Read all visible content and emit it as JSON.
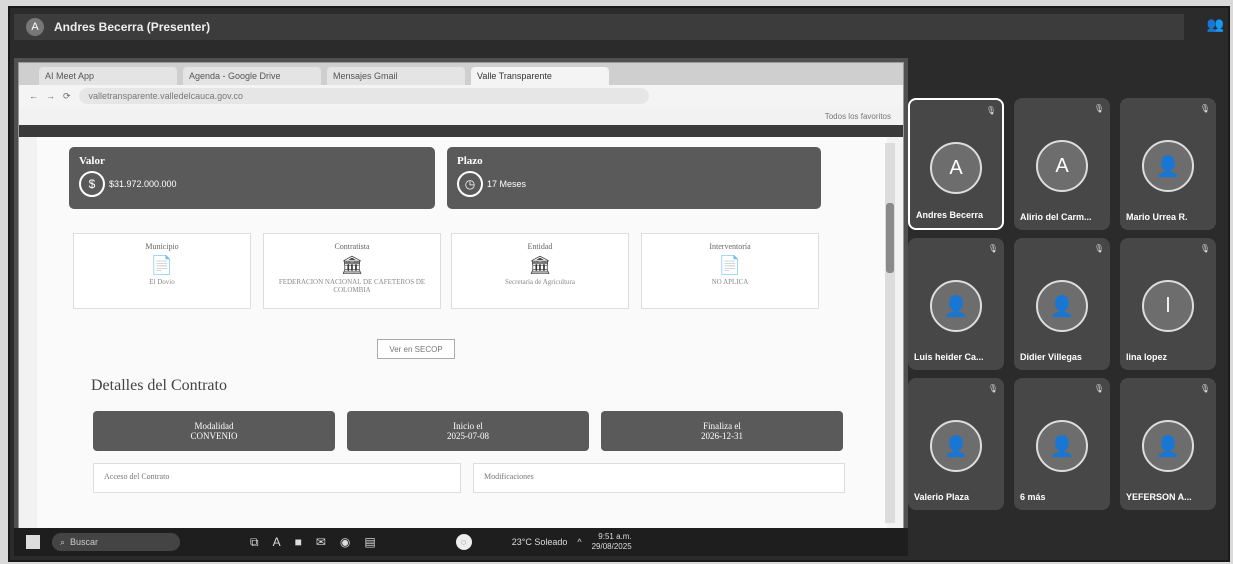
{
  "meeting": {
    "presenter_initial": "A",
    "presenter_label": "Andres Becerra (Presenter)"
  },
  "browser": {
    "tabs": [
      "AI Meet App",
      "Agenda - Google Drive",
      "Mensajes Gmail",
      "Valle Transparente"
    ],
    "url": "valletransparente.valledelcauca.gov.co",
    "bookmarks_label": "Todos los favoritos"
  },
  "page": {
    "value_card": {
      "label": "Valor",
      "amount": "$31.972.000.000"
    },
    "term_card": {
      "label": "Plazo",
      "value": "17 Meses"
    },
    "info_cards": [
      {
        "title": "Municipio",
        "icon": "📄",
        "value": "El Dovio"
      },
      {
        "title": "Contratista",
        "icon": "🏛",
        "value": "FEDERACION NACIONAL DE CAFETEROS DE COLOMBIA"
      },
      {
        "title": "Entidad",
        "icon": "🏛",
        "value": "Secretaría de Agricultura"
      },
      {
        "title": "Interventoría",
        "icon": "📄",
        "value": "NO APLICA"
      }
    ],
    "more_button": "Ver en SECOP",
    "section_title": "Detalles del Contrato",
    "details": [
      {
        "label": "Modalidad",
        "value": "CONVENIO"
      },
      {
        "label": "Inicio el",
        "value": "2025-07-08"
      },
      {
        "label": "Finaliza el",
        "value": "2026-12-31"
      }
    ],
    "subsections": [
      "Acceso del Contrato",
      "Modificaciones"
    ]
  },
  "taskbar": {
    "search": "Buscar",
    "weather": "23°C Soleado",
    "time": "9:51 a.m.",
    "date": "29/08/2025"
  },
  "participants": [
    {
      "name": "Andres Becerra",
      "initial": "A",
      "selected": true
    },
    {
      "name": "Alirio del Carm...",
      "initial": "A",
      "selected": false
    },
    {
      "name": "Mario Urrea R.",
      "initial": "",
      "selected": false
    },
    {
      "name": "Luis heider Ca...",
      "initial": "",
      "selected": false
    },
    {
      "name": "Didier Villegas",
      "initial": "",
      "selected": false
    },
    {
      "name": "lina lopez",
      "initial": "l",
      "selected": false
    },
    {
      "name": "Valerio Plaza",
      "initial": "",
      "selected": false
    },
    {
      "name": "6 más",
      "initial": "",
      "selected": false
    },
    {
      "name": "YEFERSON A...",
      "initial": "",
      "selected": false
    }
  ]
}
